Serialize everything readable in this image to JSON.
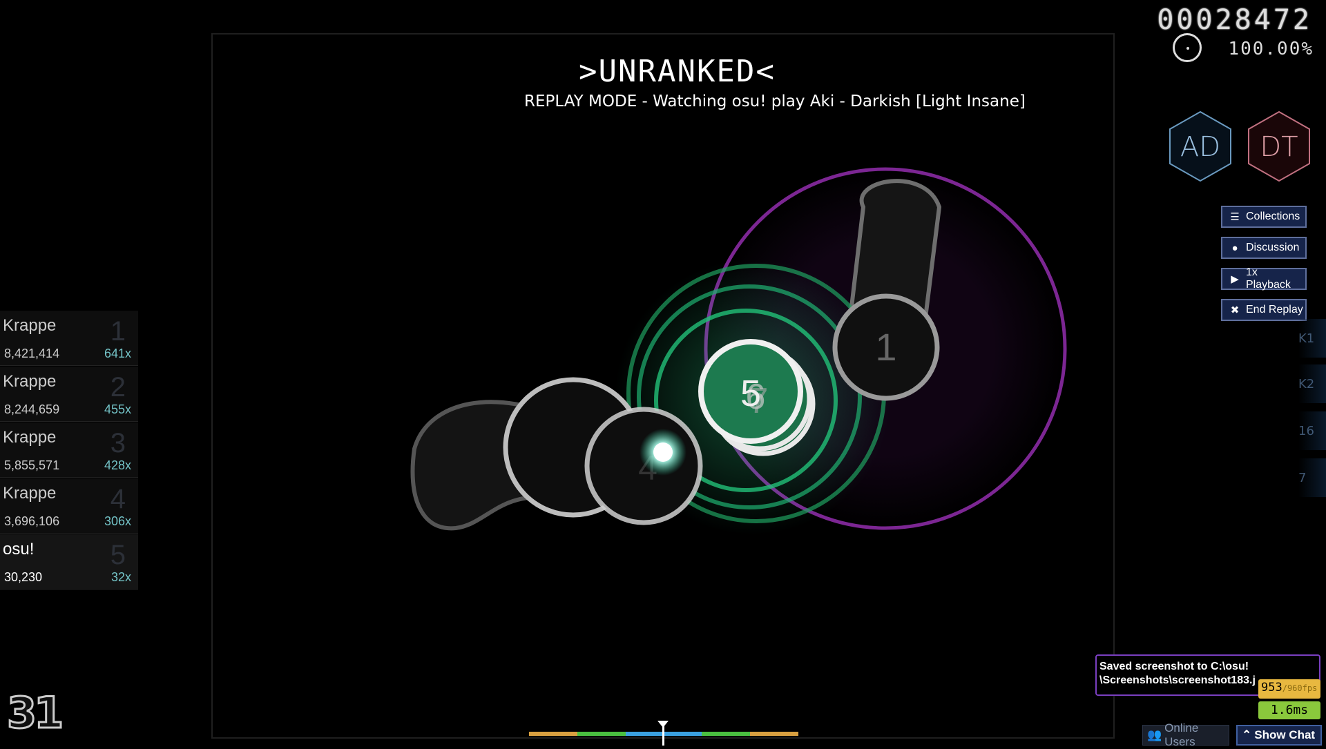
{
  "game": {
    "status_banner": ">UNRANKED<",
    "replay_text": "REPLAY MODE - Watching osu! play Aki - Darkish [Light Insane]",
    "score": "00028472",
    "accuracy": "100.00%",
    "combo": "31",
    "mods": [
      "AD",
      "DT"
    ]
  },
  "side_buttons": [
    {
      "label": "Collections",
      "icon": "list-icon"
    },
    {
      "label": "Discussion",
      "icon": "chat-bubble-icon"
    },
    {
      "label": "1x Playback",
      "icon": "play-icon"
    },
    {
      "label": "End Replay",
      "icon": "close-icon"
    }
  ],
  "keys": [
    "K1",
    "K2",
    "16",
    "7"
  ],
  "leaderboard": [
    {
      "name": "Krappe",
      "rank": "1",
      "score": "8,421,414",
      "combo": "641x"
    },
    {
      "name": "Krappe",
      "rank": "2",
      "score": "8,244,659",
      "combo": "455x"
    },
    {
      "name": "Krappe",
      "rank": "3",
      "score": "5,855,571",
      "combo": "428x"
    },
    {
      "name": "Krappe",
      "rank": "4",
      "score": "3,696,106",
      "combo": "306x"
    },
    {
      "name": "osu!",
      "rank": "5",
      "score": "30,230",
      "combo": "32x"
    }
  ],
  "hit_objects": {
    "circle_1": "1",
    "circle_4": "4",
    "stack_5": "5",
    "stack_6": "6",
    "stack_7": "7"
  },
  "notification": {
    "line1": "Saved screenshot to C:\\osu!",
    "line2": "\\Screenshots\\screenshot183.j"
  },
  "perf": {
    "fps": "953",
    "fps_max": "/960fps",
    "frame_time": "1.6ms"
  },
  "bottom": {
    "online_users": "Online Users",
    "show_chat": "Show Chat"
  },
  "colors": {
    "accent_green": "#2fd08a",
    "approach_purple": "#9b2fb8",
    "notif_border": "#7a3fc0",
    "button_bg": "#16244a"
  }
}
